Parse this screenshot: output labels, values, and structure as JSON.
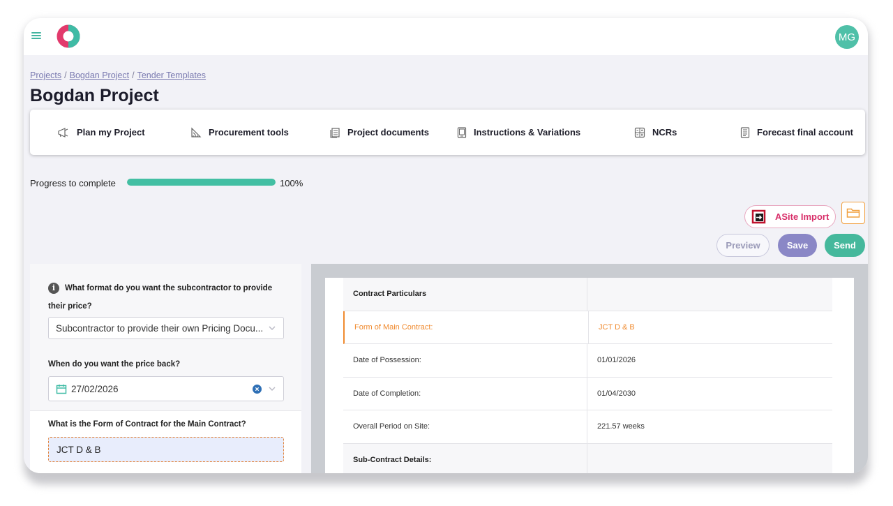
{
  "header": {
    "avatar_initials": "MG"
  },
  "breadcrumb": [
    {
      "label": "Projects"
    },
    {
      "label": "Bogdan Project"
    },
    {
      "label": "Tender Templates"
    }
  ],
  "breadcrumb_sep": "/",
  "page": {
    "title": "Bogdan Project"
  },
  "nav": [
    {
      "label": "Plan my Project",
      "icon": "megaphone-icon"
    },
    {
      "label": "Procurement tools",
      "icon": "ruler-icon"
    },
    {
      "label": "Project documents",
      "icon": "documents-icon"
    },
    {
      "label": "Instructions & Variations",
      "icon": "tablet-icon"
    },
    {
      "label": "NCRs",
      "icon": "calculator-icon"
    },
    {
      "label": "Forecast final account",
      "icon": "ledger-icon"
    }
  ],
  "progress": {
    "label": "Progress to complete",
    "value": 100,
    "value_text": "100%"
  },
  "actions": {
    "asite_import": "ASite Import",
    "preview": "Preview",
    "save": "Save",
    "send": "Send"
  },
  "form": {
    "q_price_format": "What format do you want the subcontractor to provide their price?",
    "q_price_format_value": "Subcontractor to provide their own Pricing Docu...",
    "q_price_back": "When do you want the price back?",
    "q_price_back_value": "27/02/2026",
    "q_form_contract": "What is the Form of Contract for the Main Contract?",
    "q_form_contract_value": "JCT D & B"
  },
  "document": {
    "rows": [
      {
        "label": "Contract Particulars",
        "value": ""
      },
      {
        "label": "Form of Main Contract:",
        "value": "JCT D & B"
      },
      {
        "label": "Date of Possession:",
        "value": "01/01/2026"
      },
      {
        "label": "Date of Completion:",
        "value": "01/04/2030"
      },
      {
        "label": "Overall Period on Site:",
        "value": "221.57 weeks"
      },
      {
        "label": "Sub-Contract Details:",
        "value": ""
      }
    ]
  },
  "colors": {
    "accent": "#43bfa3",
    "active_row": "#f08a2e",
    "asite": "#d8306a",
    "save": "#8a87c6"
  }
}
